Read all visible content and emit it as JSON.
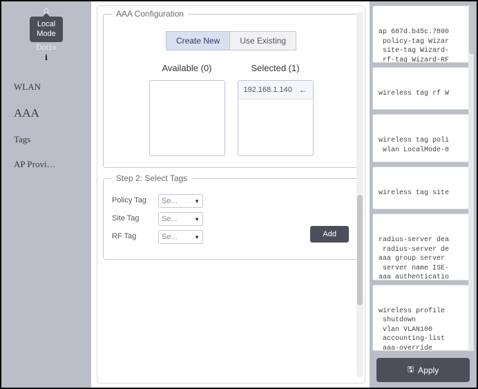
{
  "sidebar": {
    "tooltip_line1": "Local",
    "tooltip_line2": "Mode",
    "sub_label": "Dot1x",
    "nav": [
      {
        "label": "WLAN",
        "active": false
      },
      {
        "label": "AAA",
        "active": true
      },
      {
        "label": "Tags",
        "active": false
      },
      {
        "label": "AP Provi…",
        "active": false
      }
    ]
  },
  "aaa": {
    "legend": "AAA Configuration",
    "tabs": {
      "create": "Create New",
      "existing": "Use Existing",
      "active": "create"
    },
    "available": {
      "title": "Available (0)",
      "items": []
    },
    "selected": {
      "title": "Selected (1)",
      "items": [
        "192.168.1.140"
      ]
    }
  },
  "step2": {
    "legend": "Step 2: Select Tags",
    "rows": [
      {
        "label": "Policy Tag",
        "value": "Se..."
      },
      {
        "label": "Site Tag",
        "value": "Se..."
      },
      {
        "label": "RF Tag",
        "value": "Se..."
      }
    ],
    "add_label": "Add"
  },
  "snippets": [
    "ap 687d.b45c.7800\n policy-tag Wizar\n site-tag Wizard-\n rf-tag Wizard-RF",
    "wireless tag rf W",
    "wireless tag poli\n wlan LocalMode-8",
    "wireless tag site",
    "radius-server dea\n radius-server de\naaa group server \n server name ISE-\naaa authenticatio\naaa accounting id",
    "wireless profile \n shutdown\n vlan VLAN100\n accounting-list \n aaa-override\n no shutdown"
  ],
  "apply": {
    "label": "Apply"
  }
}
